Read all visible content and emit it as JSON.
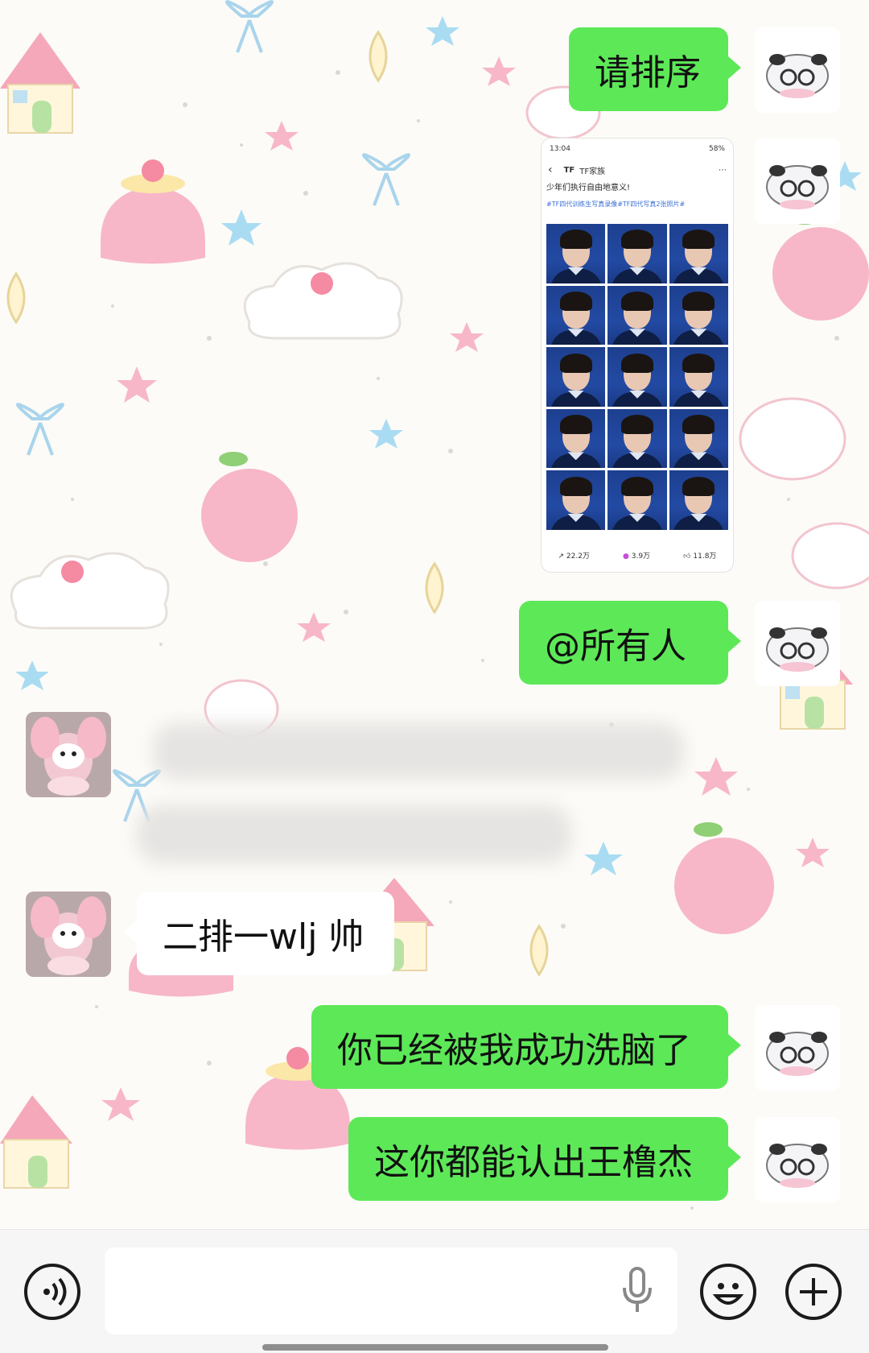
{
  "chat": {
    "messages": [
      {
        "sender": "me",
        "type": "text",
        "text": "请排序"
      },
      {
        "sender": "me",
        "type": "image",
        "image": {
          "status_time": "13:04",
          "status_right": "58%",
          "account_name": "TF家族",
          "caption": "少年们执行自由地意义!",
          "tags": "#TF四代训练生写真录像#TF四代写真2张照片#",
          "footer_share": "22.2万",
          "footer_gift": "3.9万",
          "footer_like": "11.8万"
        }
      },
      {
        "sender": "me",
        "type": "text",
        "text": "@所有人"
      },
      {
        "sender": "other",
        "type": "redacted"
      },
      {
        "sender": "other",
        "type": "text",
        "text": "二排一wlj 帅"
      },
      {
        "sender": "me",
        "type": "text",
        "text": "你已经被我成功洗脑了"
      },
      {
        "sender": "me",
        "type": "text",
        "text": "这你都能认出王橹杰"
      }
    ]
  },
  "input_bar": {
    "voice_icon": "voice-wave-icon",
    "mic_icon": "microphone-icon",
    "emoji_icon": "smiley-icon",
    "plus_icon": "plus-icon"
  },
  "colors": {
    "my_bubble": "#5de858",
    "other_bubble": "#ffffff",
    "chat_background": "#fcfbf7",
    "input_bar": "#f6f6f6"
  }
}
